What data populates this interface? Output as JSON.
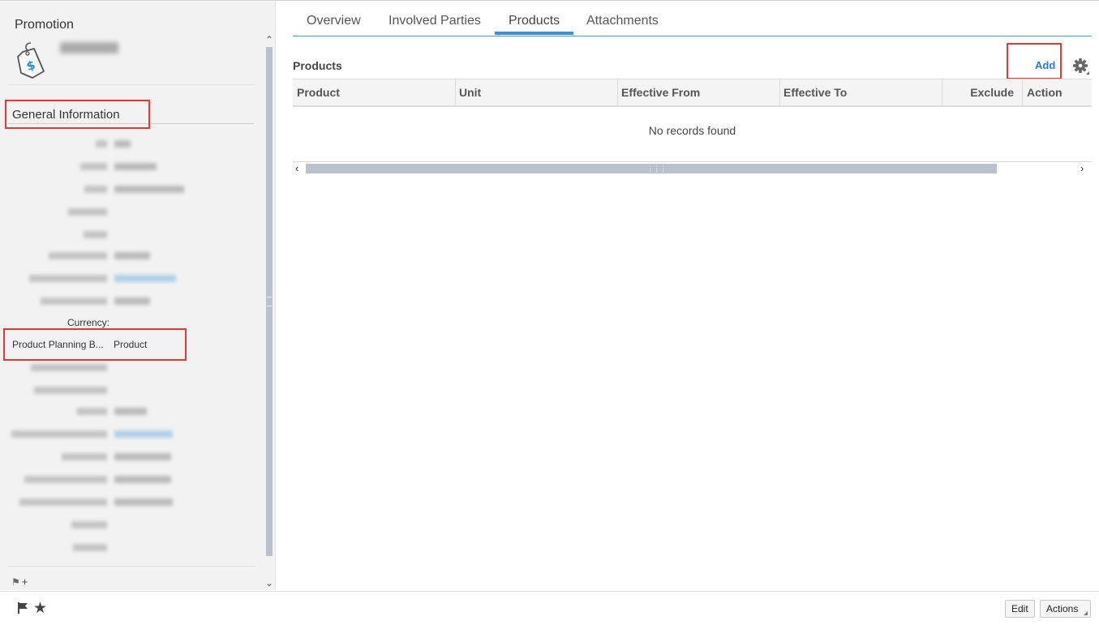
{
  "left_panel": {
    "object_type": "Promotion",
    "section_title": "General Information",
    "fields": [
      {
        "label": "Currency:",
        "value": ""
      },
      {
        "label": "Product Planning B...",
        "value": "Product"
      }
    ]
  },
  "tabs": [
    {
      "label": "Overview"
    },
    {
      "label": "Involved Parties"
    },
    {
      "label": "Products"
    },
    {
      "label": "Attachments"
    }
  ],
  "active_tab": "Products",
  "products": {
    "title": "Products",
    "add_label": "Add",
    "columns": [
      "Product",
      "Unit",
      "Effective From",
      "Effective To",
      "Exclude",
      "Action"
    ],
    "empty_message": "No records found"
  },
  "footer": {
    "edit_label": "Edit",
    "actions_label": "Actions"
  },
  "colors": {
    "accent": "#3a8fd6",
    "link": "#2a7bd0",
    "highlight_box": "#e53935",
    "scrollbar": "#b9c2cc"
  },
  "icons": [
    "price-tag-icon",
    "settings-gear-icon",
    "flag-icon",
    "star-icon",
    "tag-add-icon",
    "chevron-left-icon",
    "chevron-right-icon",
    "chevron-up-icon",
    "chevron-down-icon"
  ]
}
